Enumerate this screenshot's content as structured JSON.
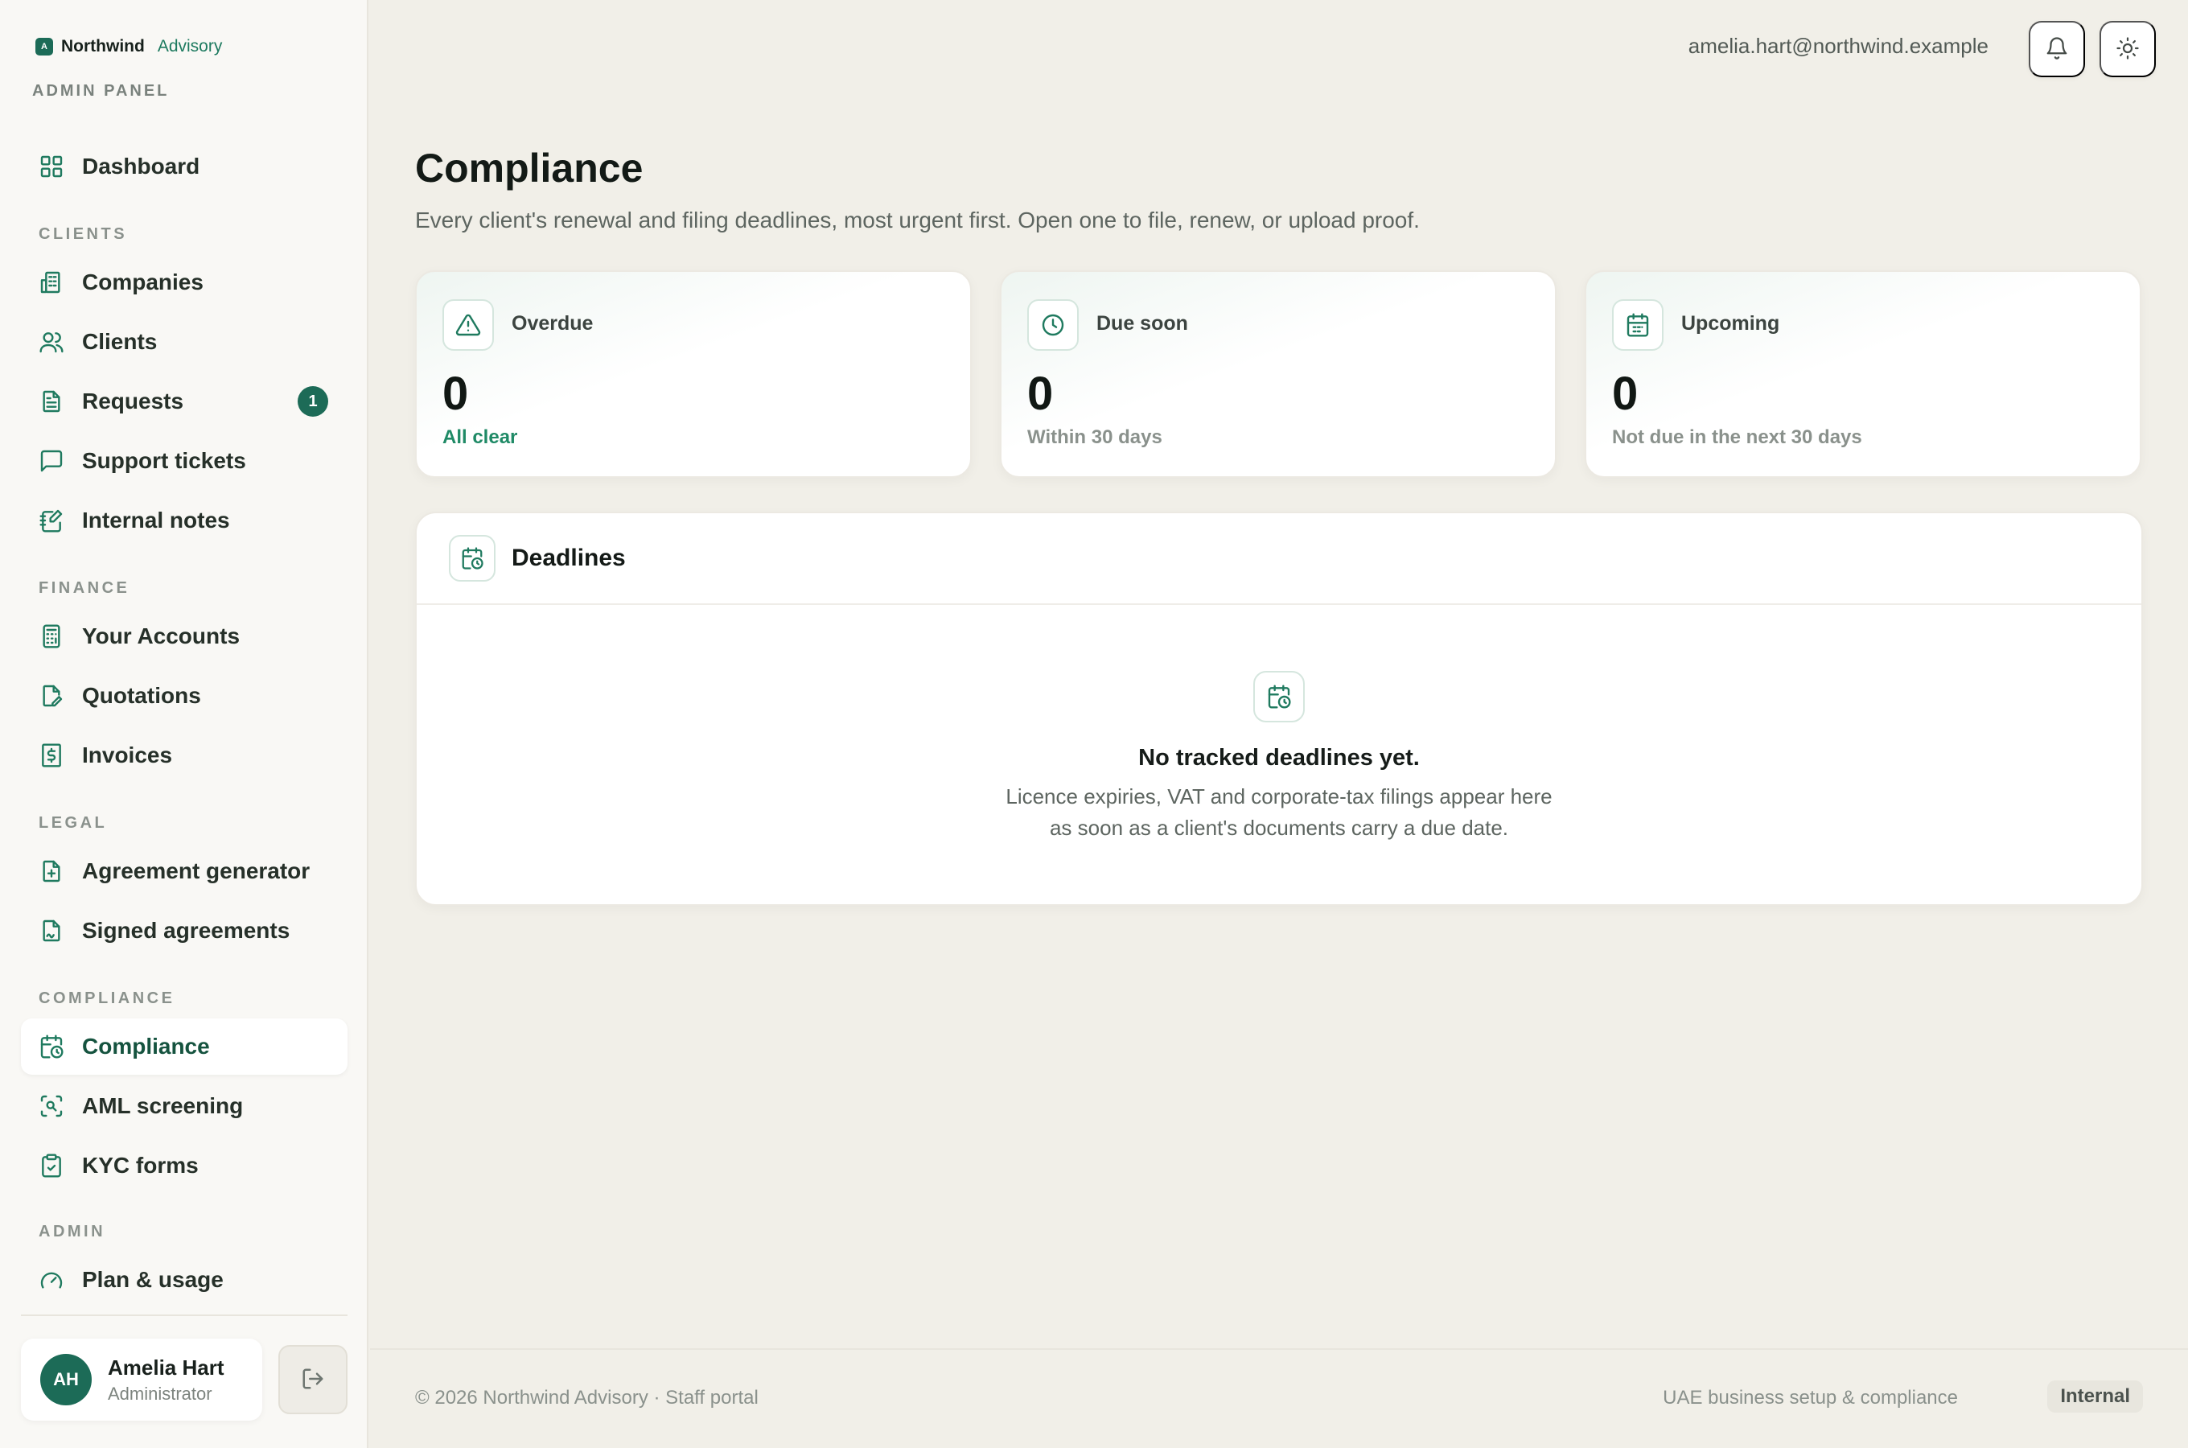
{
  "brand": {
    "logo_letter": "A",
    "name": "Northwind",
    "sub": "Advisory",
    "panel_label": "ADMIN PANEL"
  },
  "nav": {
    "dashboard": "Dashboard",
    "section_clients": "CLIENTS",
    "companies": "Companies",
    "clients": "Clients",
    "requests": "Requests",
    "requests_badge": "1",
    "support_tickets": "Support tickets",
    "internal_notes": "Internal notes",
    "section_finance": "FINANCE",
    "your_accounts": "Your Accounts",
    "quotations": "Quotations",
    "invoices": "Invoices",
    "section_legal": "LEGAL",
    "agreement_generator": "Agreement generator",
    "signed_agreements": "Signed agreements",
    "section_compliance": "COMPLIANCE",
    "compliance": "Compliance",
    "aml_screening": "AML screening",
    "kyc_forms": "KYC forms",
    "section_admin": "ADMIN",
    "plan_usage": "Plan & usage"
  },
  "user": {
    "initials": "AH",
    "name": "Amelia Hart",
    "role": "Administrator",
    "email": "amelia.hart@northwind.example"
  },
  "page": {
    "title": "Compliance",
    "subtitle": "Every client's renewal and filing deadlines, most urgent first. Open one to file, renew, or upload proof."
  },
  "stats": {
    "overdue": {
      "label": "Overdue",
      "value": "0",
      "note": "All clear"
    },
    "due_soon": {
      "label": "Due soon",
      "value": "0",
      "note": "Within 30 days"
    },
    "upcoming": {
      "label": "Upcoming",
      "value": "0",
      "note": "Not due in the next 30 days"
    }
  },
  "deadlines": {
    "title": "Deadlines",
    "empty_title": "No tracked deadlines yet.",
    "empty_text": "Licence expiries, VAT and corporate-tax filings appear here as soon as a client's documents carry a due date."
  },
  "footer": {
    "left": "© 2026 Northwind Advisory · Staff portal",
    "right": "UAE business setup & compliance",
    "badge": "Internal"
  },
  "colors": {
    "accent": "#1c6b57",
    "accent_text": "#1f7a5f",
    "background": "#f1efe8"
  },
  "icons": {
    "bell": "bell-icon",
    "theme": "sun-icon",
    "logout": "logout-icon"
  }
}
